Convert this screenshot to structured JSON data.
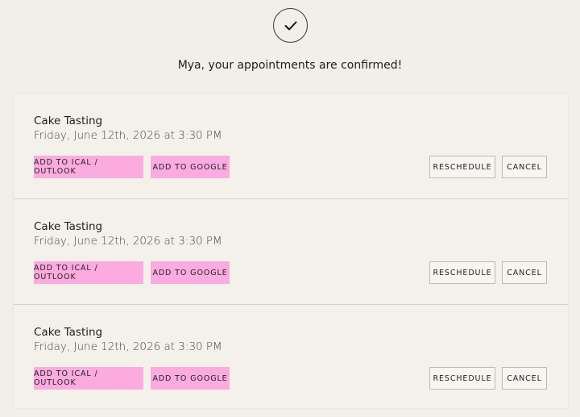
{
  "confirmation": {
    "message": "Mya, your appointments are confirmed!"
  },
  "appointments": [
    {
      "title": "Cake Tasting",
      "datetime": "Friday, June 12th, 2026 at 3:30 PM",
      "ical_label": "ADD TO ICAL / OUTLOOK",
      "google_label": "ADD TO GOOGLE",
      "reschedule_label": "RESCHEDULE",
      "cancel_label": "CANCEL"
    },
    {
      "title": "Cake Tasting",
      "datetime": "Friday, June 12th, 2026 at 3:30 PM",
      "ical_label": "ADD TO ICAL / OUTLOOK",
      "google_label": "ADD TO GOOGLE",
      "reschedule_label": "RESCHEDULE",
      "cancel_label": "CANCEL"
    },
    {
      "title": "Cake Tasting",
      "datetime": "Friday, June 12th, 2026 at 3:30 PM",
      "ical_label": "ADD TO ICAL / OUTLOOK",
      "google_label": "ADD TO GOOGLE",
      "reschedule_label": "RESCHEDULE",
      "cancel_label": "CANCEL"
    }
  ],
  "colors": {
    "background": "#f2efe8",
    "accent_pink": "#fbabdf",
    "outline": "#bdbab3"
  },
  "icons": {
    "confirmation": "checkmark-icon"
  }
}
